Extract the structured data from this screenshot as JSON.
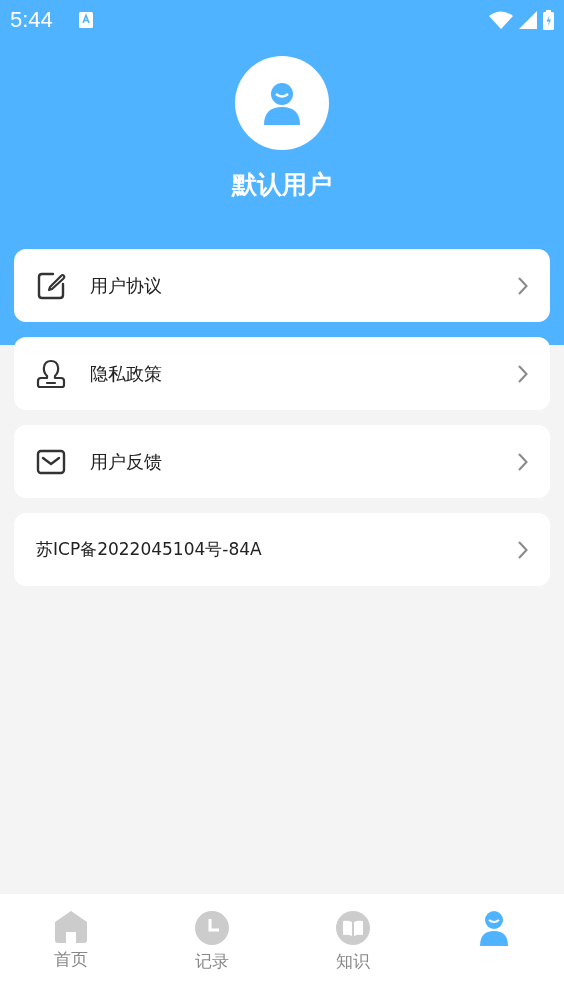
{
  "status_bar": {
    "time": "5:44"
  },
  "profile": {
    "name": "默认用户"
  },
  "menu": [
    {
      "kind": "edit",
      "label": "用户协议"
    },
    {
      "kind": "stamp",
      "label": "隐私政策"
    },
    {
      "kind": "mail",
      "label": "用户反馈"
    },
    {
      "kind": "text",
      "label": "苏ICP备2022045104号-84A"
    }
  ],
  "tabs": [
    {
      "kind": "home",
      "label": "首页",
      "selected": false
    },
    {
      "kind": "clock",
      "label": "记录",
      "selected": false
    },
    {
      "kind": "book",
      "label": "知识",
      "selected": false
    },
    {
      "kind": "user",
      "selected": true
    }
  ]
}
